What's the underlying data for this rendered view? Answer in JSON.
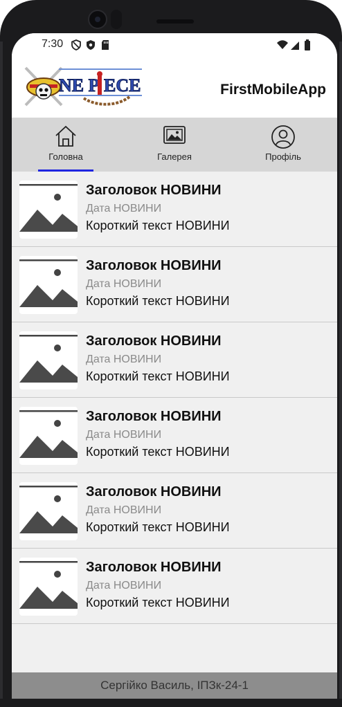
{
  "status_bar": {
    "time": "7:30"
  },
  "header": {
    "app_title": "FirstMobileApp",
    "logo_text": "ONE PIECE"
  },
  "tabs": [
    {
      "label": "Головна",
      "icon": "home-icon",
      "selected": true
    },
    {
      "label": "Галерея",
      "icon": "gallery-icon",
      "selected": false
    },
    {
      "label": "Профіль",
      "icon": "profile-icon",
      "selected": false
    }
  ],
  "news": [
    {
      "title": "Заголовок НОВИНИ",
      "date": "Дата НОВИНИ",
      "text": "Короткий текст НОВИНИ"
    },
    {
      "title": "Заголовок НОВИНИ",
      "date": "Дата НОВИНИ",
      "text": "Короткий текст НОВИНИ"
    },
    {
      "title": "Заголовок НОВИНИ",
      "date": "Дата НОВИНИ",
      "text": "Короткий текст НОВИНИ"
    },
    {
      "title": "Заголовок НОВИНИ",
      "date": "Дата НОВИНИ",
      "text": "Короткий текст НОВИНИ"
    },
    {
      "title": "Заголовок НОВИНИ",
      "date": "Дата НОВИНИ",
      "text": "Короткий текст НОВИНИ"
    },
    {
      "title": "Заголовок НОВИНИ",
      "date": "Дата НОВИНИ",
      "text": "Короткий текст НОВИНИ"
    }
  ],
  "footer": {
    "text": "Сергійко Василь, ІПЗк-24-1"
  },
  "colors": {
    "tab_indicator": "#1f25e0",
    "tab_bar": "#d6d6d6",
    "footer": "#8d8d8d",
    "list_bg": "#f0f0f0"
  }
}
